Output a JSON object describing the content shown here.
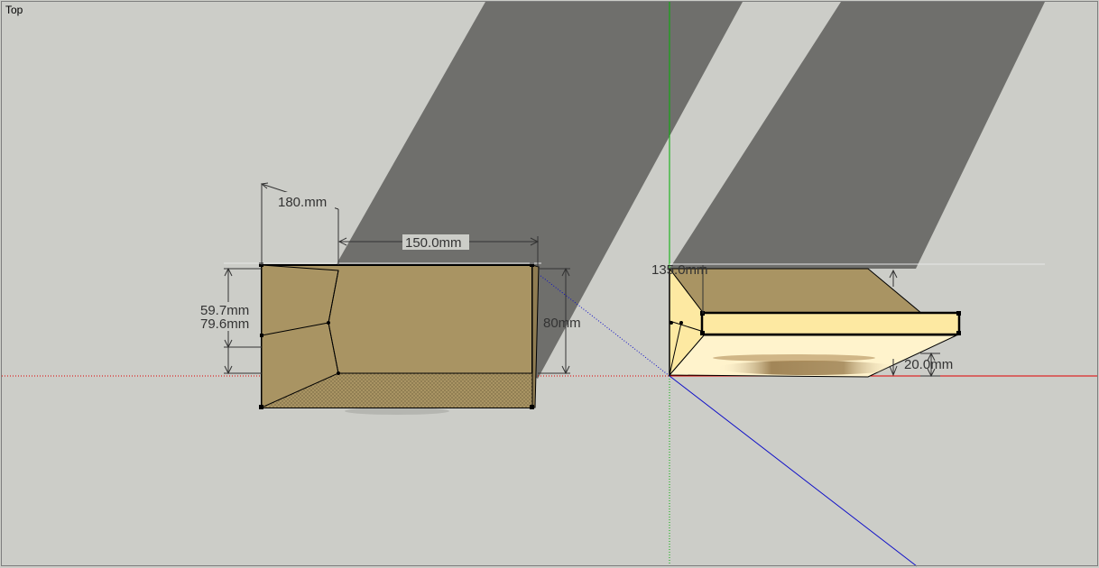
{
  "viewport": {
    "view_name": "Top",
    "background_color": "#cccdc8",
    "shadow_color": "#6f6f6c",
    "face_color": "#a99463",
    "face_light_color": "#fde9a2",
    "axis_colors": {
      "red": "#e00000",
      "green": "#00b000",
      "blue": "#1010c8"
    }
  },
  "dimensions": {
    "dim_180": "180.mm",
    "dim_150": "150.0mm",
    "dim_59_7": "59.7mm",
    "dim_79_6": "79.6mm",
    "dim_80": "80mm",
    "dim_135": "135.0mm",
    "dim_20": "20.0mm"
  }
}
